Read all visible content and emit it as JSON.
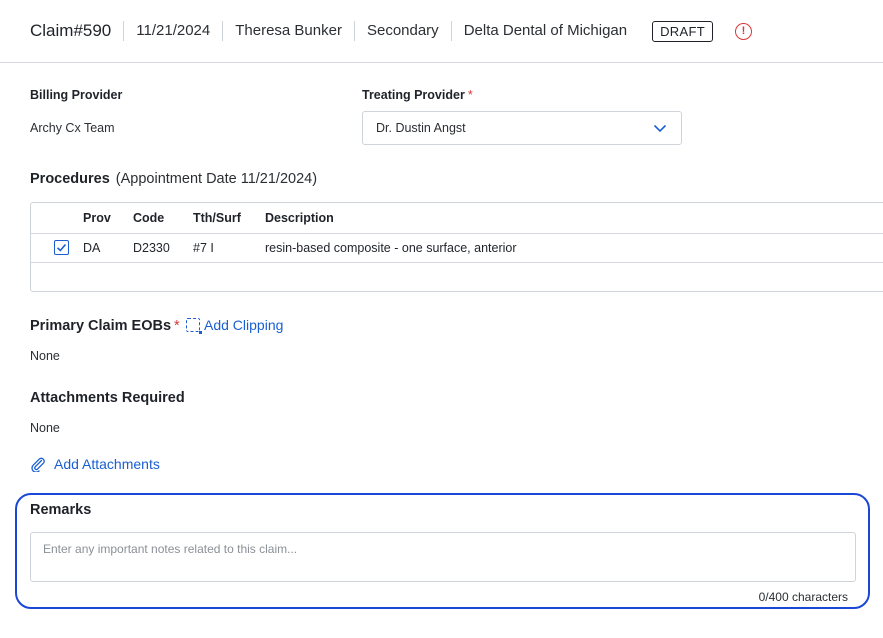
{
  "header": {
    "claim_title": "Claim#590",
    "date": "11/21/2024",
    "patient": "Theresa Bunker",
    "coverage": "Secondary",
    "payer": "Delta Dental of Michigan",
    "status_badge": "DRAFT",
    "alert_symbol": "!"
  },
  "billing": {
    "label": "Billing Provider",
    "value": "Archy Cx Team"
  },
  "treating": {
    "label": "Treating Provider",
    "required_mark": "*",
    "selected": "Dr. Dustin Angst"
  },
  "procedures": {
    "title": "Procedures",
    "subtitle": "(Appointment Date 11/21/2024)",
    "columns": [
      "Prov",
      "Code",
      "Tth/Surf",
      "Description"
    ],
    "rows": [
      {
        "checked": true,
        "prov": "DA",
        "code": "D2330",
        "tooth_surf": "#7 I",
        "description": "resin-based composite - one surface, anterior"
      }
    ]
  },
  "eobs": {
    "title": "Primary Claim EOBs",
    "required_mark": "*",
    "add_clipping": "Add Clipping",
    "value": "None"
  },
  "attachments": {
    "title": "Attachments Required",
    "value": "None",
    "add_label": "Add Attachments"
  },
  "remarks": {
    "title": "Remarks",
    "placeholder": "Enter any important notes related to this claim...",
    "value": "",
    "char_count": "0/400 characters"
  },
  "colors": {
    "accent": "#1a5fd1",
    "focus_ring": "#1a47d6",
    "error": "#d9373b"
  }
}
